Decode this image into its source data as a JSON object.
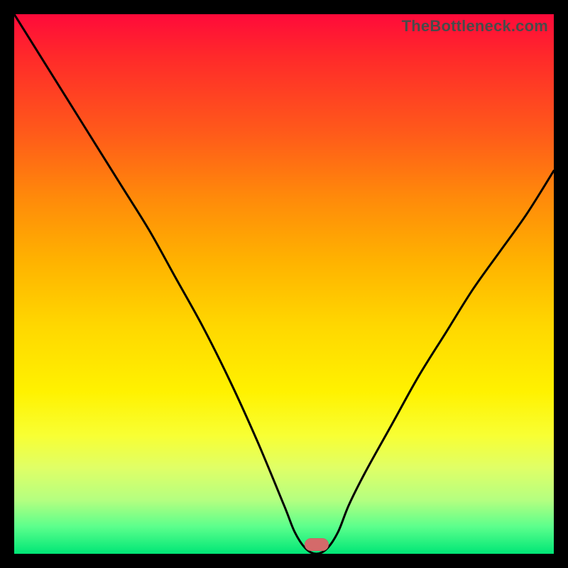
{
  "watermark": "TheBottleneck.com",
  "marker": {
    "color": "#d46a6a"
  },
  "chart_data": {
    "type": "line",
    "title": "",
    "xlabel": "",
    "ylabel": "",
    "xlim": [
      0,
      100
    ],
    "ylim": [
      0,
      100
    ],
    "grid": false,
    "legend": false,
    "annotations": [
      {
        "text": "TheBottleneck.com",
        "pos": "top-right"
      }
    ],
    "series": [
      {
        "name": "bottleneck-curve",
        "x": [
          0,
          5,
          10,
          15,
          20,
          25,
          30,
          35,
          40,
          45,
          50,
          52,
          54,
          56,
          58,
          60,
          62,
          65,
          70,
          75,
          80,
          85,
          90,
          95,
          100
        ],
        "values": [
          100,
          92,
          84,
          76,
          68,
          60,
          51,
          42,
          32,
          21,
          9,
          4,
          1,
          0,
          1,
          4,
          9,
          15,
          24,
          33,
          41,
          49,
          56,
          63,
          71
        ]
      }
    ],
    "valley": {
      "x": 56,
      "y": 0
    },
    "background_gradient": {
      "top": "#ff0a3a",
      "mid": "#ffe500",
      "bottom": "#00e676"
    }
  }
}
